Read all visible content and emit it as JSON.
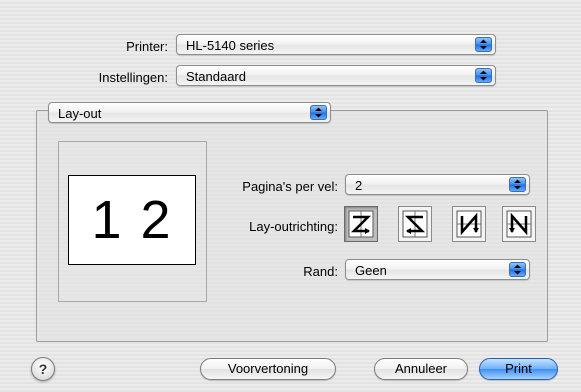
{
  "printer": {
    "label": "Printer:",
    "value": "HL-5140 series"
  },
  "settings": {
    "label": "Instellingen:",
    "value": "Standaard"
  },
  "panel": {
    "value": "Lay-out"
  },
  "layout": {
    "preview_text": "1 2",
    "pages_per_sheet_label": "Pagina's per vel:",
    "pages_per_sheet_value": "2",
    "direction_label": "Lay-outrichting:",
    "direction_icons": [
      "z-direction-icon",
      "reverse-z-direction-icon",
      "n-direction-icon",
      "reverse-n-direction-icon"
    ],
    "selected_direction": 0,
    "border_label": "Rand:",
    "border_value": "Geen"
  },
  "buttons": {
    "help": "?",
    "preview": "Voorvertoning",
    "cancel": "Annuleer",
    "print": "Print"
  },
  "colors": {
    "accent": "#3e8ff2",
    "background": "#e8e8e8"
  }
}
